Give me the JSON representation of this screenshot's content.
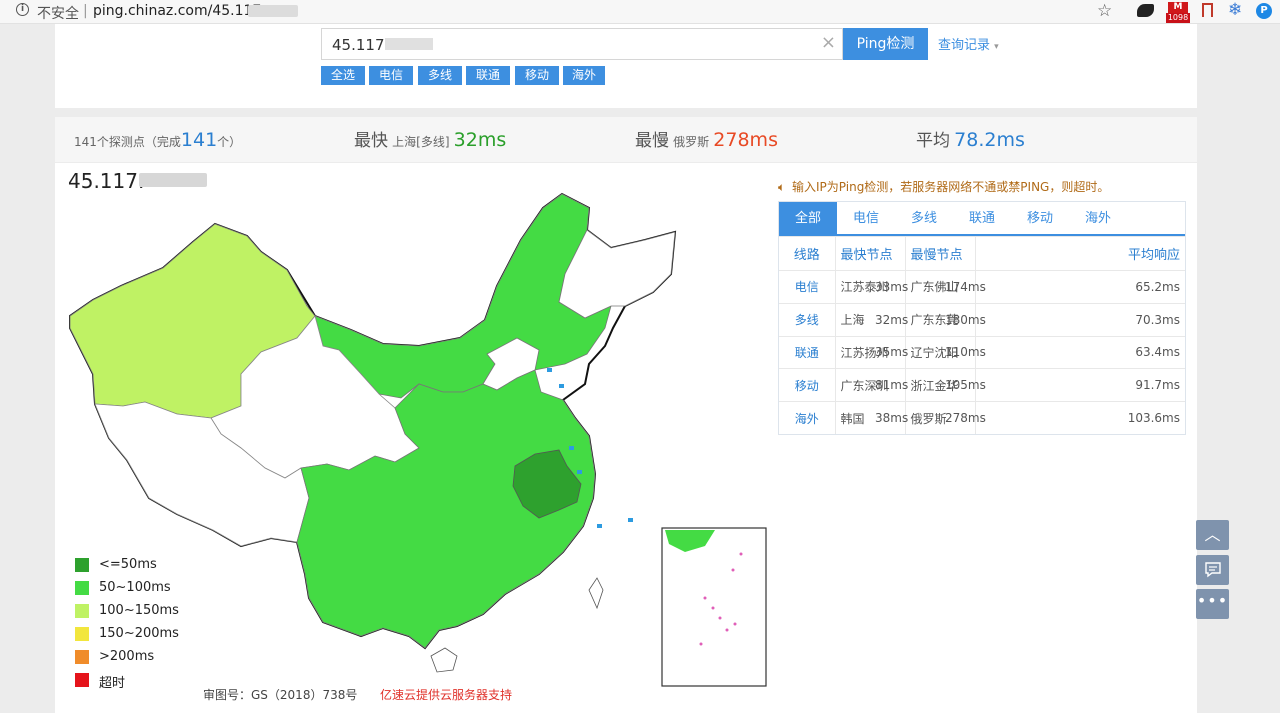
{
  "browser": {
    "insecure_label": "不安全",
    "separator": "|",
    "url": "ping.chinaz.com/45.117",
    "mail_badge": "1098"
  },
  "search": {
    "value": "45.117",
    "clear": "×",
    "ping_button": "Ping检测",
    "history_link": "查询记录",
    "history_caret": "▾"
  },
  "filters": [
    "全选",
    "电信",
    "多线",
    "联通",
    "移动",
    "海外"
  ],
  "stats": {
    "probe_prefix": "141个探测点（完成",
    "probe_done": "141",
    "probe_suffix": "个）",
    "fastest_label": "最快",
    "fastest_node": "上海[多线]",
    "fastest_value": "32ms",
    "slowest_label": "最慢",
    "slowest_node": "俄罗斯",
    "slowest_value": "278ms",
    "avg_label": "平均",
    "avg_value": "78.2ms"
  },
  "ip_title": "45.117.",
  "notice": "输入IP为Ping检测，若服务器网络不通或禁PING，则超时。",
  "tabs": [
    "全部",
    "电信",
    "多线",
    "联通",
    "移动",
    "海外"
  ],
  "table": {
    "headers": [
      "线路",
      "最快节点",
      "最慢节点",
      "平均响应"
    ],
    "rows": [
      {
        "line": "电信",
        "fast_node": "江苏泰州",
        "fast_val": "33ms",
        "slow_node": "广东佛山",
        "slow_val": "174ms",
        "avg": "65.2ms"
      },
      {
        "line": "多线",
        "fast_node": "上海",
        "fast_val": "32ms",
        "slow_node": "广东东莞",
        "slow_val": "180ms",
        "avg": "70.3ms"
      },
      {
        "line": "联通",
        "fast_node": "江苏扬州",
        "fast_val": "35ms",
        "slow_node": "辽宁沈阳",
        "slow_val": "110ms",
        "avg": "63.4ms"
      },
      {
        "line": "移动",
        "fast_node": "广东深圳",
        "fast_val": "81ms",
        "slow_node": "浙江金华",
        "slow_val": "105ms",
        "avg": "91.7ms"
      },
      {
        "line": "海外",
        "fast_node": "韩国",
        "fast_val": "38ms",
        "slow_node": "俄罗斯",
        "slow_val": "278ms",
        "avg": "103.6ms"
      }
    ]
  },
  "legend": [
    {
      "label": "<=50ms",
      "color": "#2ea12e"
    },
    {
      "label": "50~100ms",
      "color": "#44db44"
    },
    {
      "label": "100~150ms",
      "color": "#bff264"
    },
    {
      "label": "150~200ms",
      "color": "#f2e63d"
    },
    {
      "label": ">200ms",
      "color": "#f08c2a"
    },
    {
      "label": "超时",
      "color": "#e5141b"
    }
  ],
  "map_colors": {
    "le50": "#2ea12e",
    "r50_100": "#44db44",
    "r100_150": "#bff264",
    "none": "#ffffff"
  },
  "approval": "审图号：GS（2018）738号",
  "sponsor": "亿速云提供云服务器支持",
  "side": {
    "up": "︿",
    "more": "•••"
  }
}
